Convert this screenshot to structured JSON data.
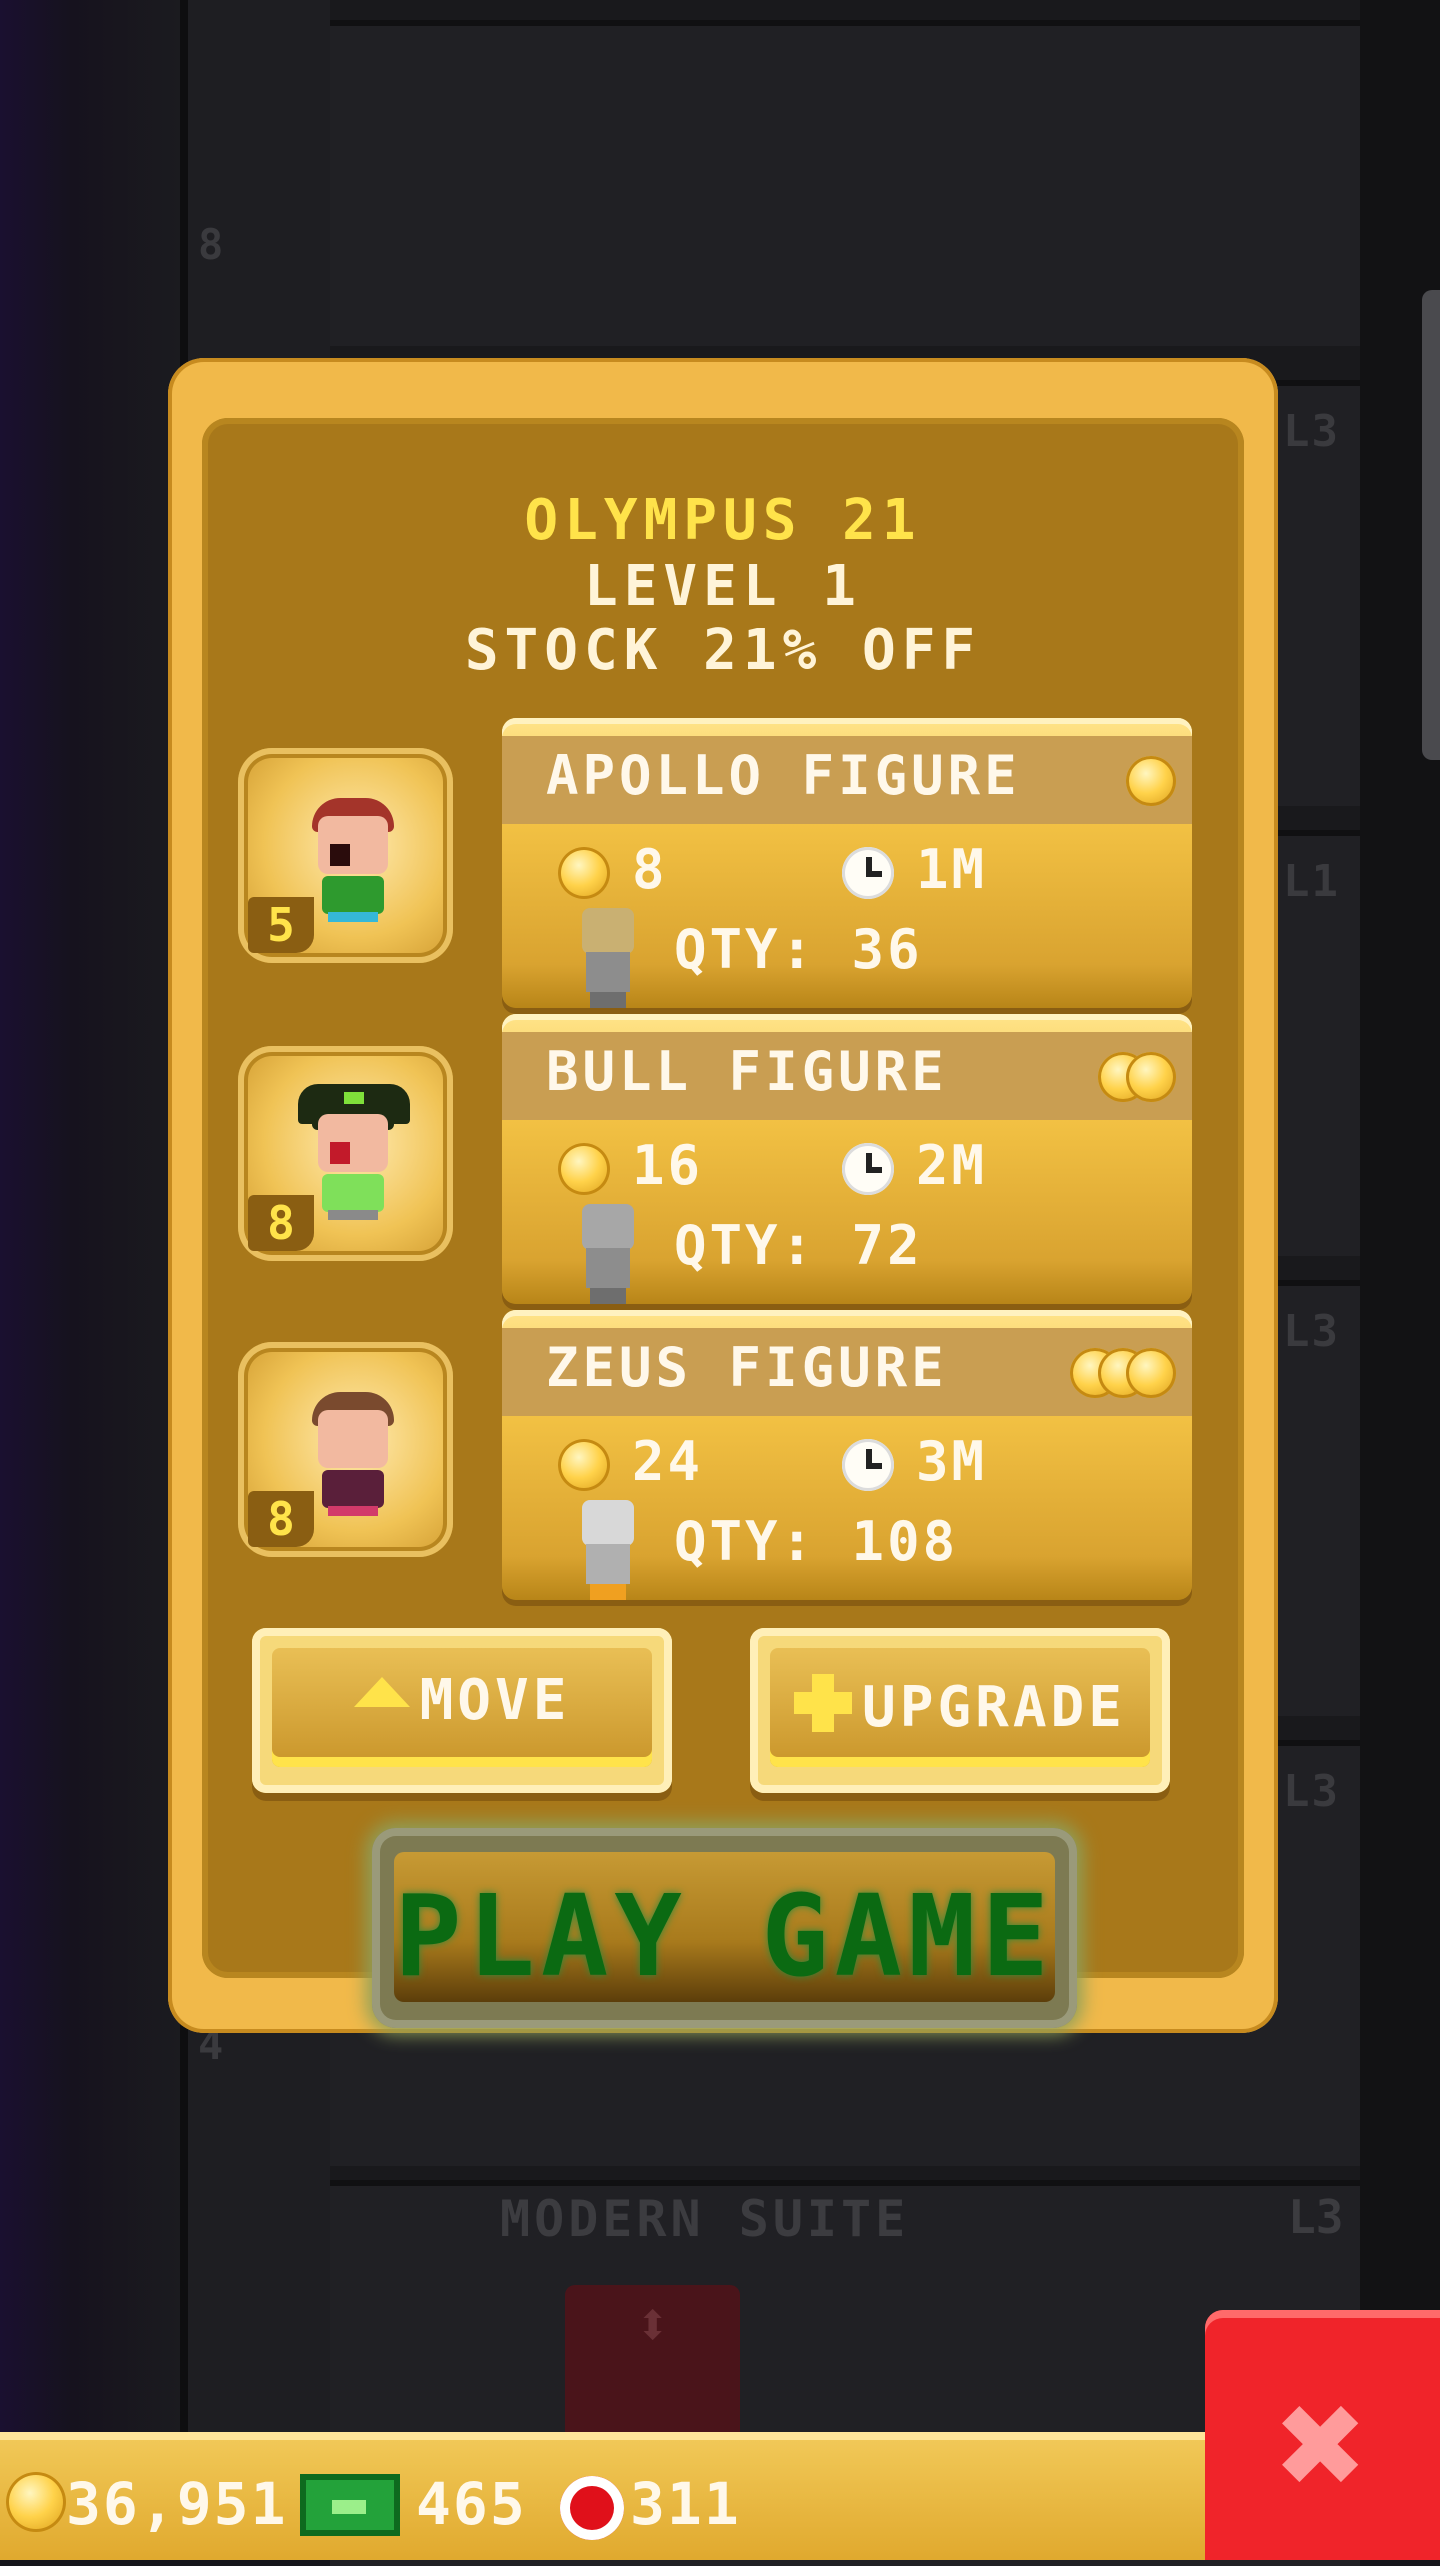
{
  "background": {
    "floor_tags": [
      "L3",
      "L1",
      "L3",
      "L3",
      "L3"
    ],
    "floor_numbers": [
      "8",
      "4"
    ],
    "suite_label": "MODERN SUITE"
  },
  "modal": {
    "title": "OLYMPUS 21",
    "level": "LEVEL 1",
    "stock_note": "STOCK 21% OFF",
    "products": [
      {
        "name": "APOLLO FIGURE",
        "worker_level": "5",
        "cost": "8",
        "time": "1M",
        "qty": "QTY: 36",
        "tier_coins": 1
      },
      {
        "name": "BULL FIGURE",
        "worker_level": "8",
        "cost": "16",
        "time": "2M",
        "qty": "QTY: 72",
        "tier_coins": 2
      },
      {
        "name": "ZEUS FIGURE",
        "worker_level": "8",
        "cost": "24",
        "time": "3M",
        "qty": "QTY: 108",
        "tier_coins": 3
      }
    ],
    "move_label": "MOVE",
    "upgrade_label": "UPGRADE",
    "play_label": "PLAY GAME"
  },
  "hud": {
    "coins": "36,951",
    "bux": "465",
    "chips": "311",
    "close_label": "✖"
  },
  "colors": {
    "title_yellow": "#ffe34a",
    "panel_gold": "#a8781a",
    "play_green": "#0b6a12",
    "close_red": "#f0242a"
  }
}
